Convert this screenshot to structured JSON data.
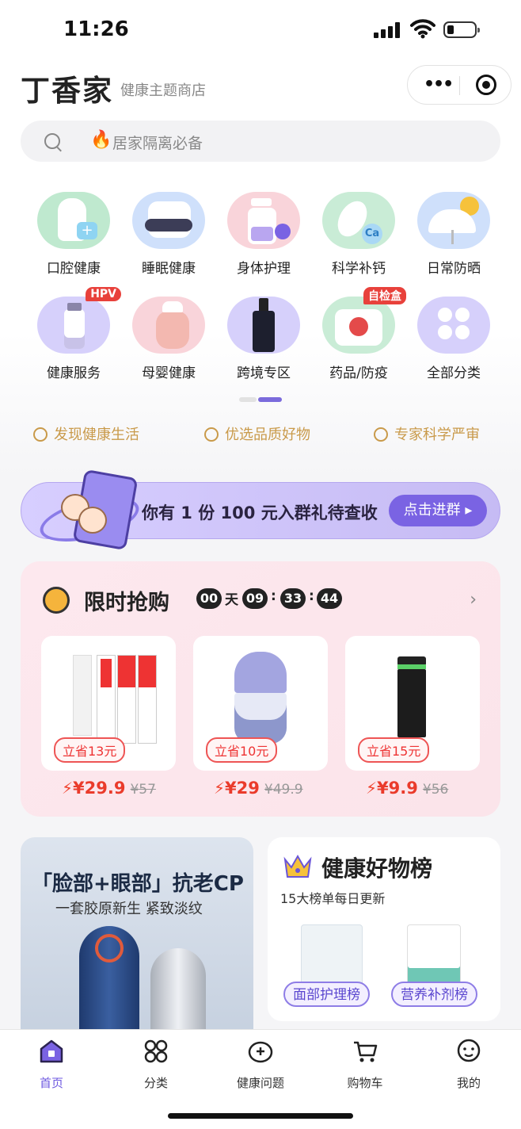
{
  "status": {
    "time": "11:26"
  },
  "header": {
    "brand": "丁香家",
    "subtitle": "健康主题商店"
  },
  "search": {
    "placeholder": "居家隔离必备",
    "icon": "fire-icon"
  },
  "categories": [
    {
      "label": "口腔健康",
      "color": "#bfe9cf"
    },
    {
      "label": "睡眠健康",
      "color": "#cfe0fb"
    },
    {
      "label": "身体护理",
      "color": "#f9d4da"
    },
    {
      "label": "科学补钙",
      "color": "#c9ecd6"
    },
    {
      "label": "日常防晒",
      "color": "#cfe0fb"
    },
    {
      "label": "健康服务",
      "color": "#d6d0fb",
      "badge": "HPV"
    },
    {
      "label": "母婴健康",
      "color": "#f9d4da"
    },
    {
      "label": "跨境专区",
      "color": "#d6d0fb"
    },
    {
      "label": "药品/防疫",
      "color": "#c9ecd6",
      "badge": "自检盒"
    },
    {
      "label": "全部分类",
      "color": "#d6d0fb"
    }
  ],
  "features": [
    "发现健康生活",
    "优选品质好物",
    "专家科学严审"
  ],
  "group_banner": {
    "text": "你有 1 份 100 元入群礼待查收",
    "button": "点击进群"
  },
  "flash_sale": {
    "title": "限时抢购",
    "countdown": {
      "days": "00",
      "day_unit": "天",
      "hours": "09",
      "minutes": "33",
      "seconds": "44",
      "sep": ":"
    },
    "products": [
      {
        "save": "立省13元",
        "price": "¥29.9",
        "original": "¥57"
      },
      {
        "save": "立省10元",
        "price": "¥29",
        "original": "¥49.9"
      },
      {
        "save": "立省15元",
        "price": "¥9.9",
        "original": "¥56"
      }
    ]
  },
  "promo_left": {
    "title": "「脸部+眼部」抗老CP",
    "subtitle": "一套胶原新生  紧致淡纹"
  },
  "promo_right": {
    "title": "健康好物榜",
    "subtitle": "15大榜单每日更新",
    "ranks": [
      "面部护理榜",
      "营养补剂榜"
    ]
  },
  "tabbar": [
    {
      "label": "首页",
      "icon": "home-icon",
      "active": true
    },
    {
      "label": "分类",
      "icon": "category-icon"
    },
    {
      "label": "健康问题",
      "icon": "health-question-icon"
    },
    {
      "label": "购物车",
      "icon": "cart-icon"
    },
    {
      "label": "我的",
      "icon": "profile-icon"
    }
  ],
  "colors": {
    "accent": "#7a63e3",
    "price": "#ea3b2b",
    "gold": "#c99a4a"
  }
}
